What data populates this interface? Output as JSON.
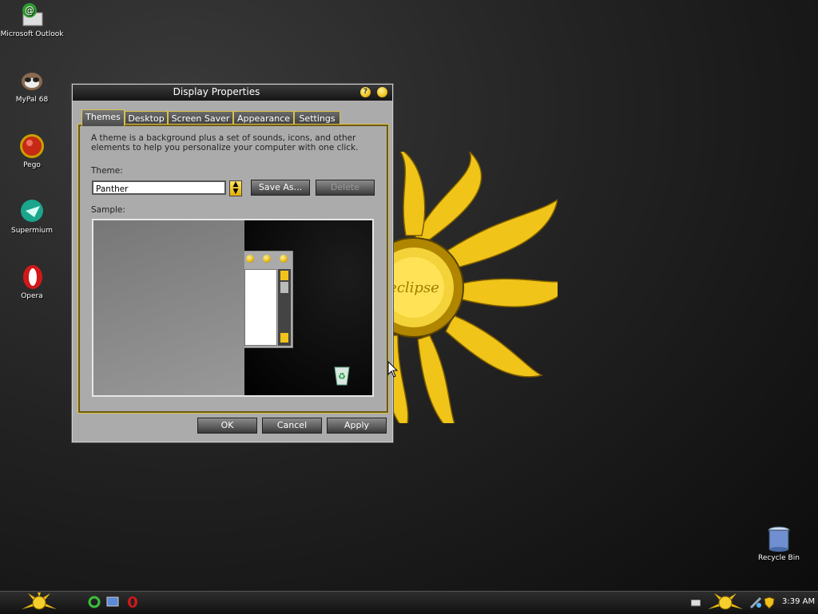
{
  "desktop": {
    "icons": [
      {
        "label": "Microsoft Outlook",
        "icon": "outlook-icon"
      },
      {
        "label": "MyPal 68",
        "icon": "mypal-icon"
      },
      {
        "label": "Pego",
        "icon": "pego-icon"
      },
      {
        "label": "Supermium",
        "icon": "supermium-icon"
      },
      {
        "label": "Opera",
        "icon": "opera-icon"
      },
      {
        "label": "Recycle Bin",
        "icon": "recycle-bin-icon"
      }
    ],
    "wallpaper_text": "eclipse"
  },
  "dialog": {
    "title": "Display Properties",
    "help_glyph": "?",
    "tabs": [
      {
        "label": "Themes",
        "active": true
      },
      {
        "label": "Desktop"
      },
      {
        "label": "Screen Saver"
      },
      {
        "label": "Appearance"
      },
      {
        "label": "Settings"
      }
    ],
    "description": "A theme is a background plus a set of sounds, icons, and other elements to help you personalize your computer with one click.",
    "theme_label": "Theme:",
    "theme_value": "Panther",
    "save_as_label": "Save As...",
    "delete_label": "Delete",
    "sample_label": "Sample:",
    "ok_label": "OK",
    "cancel_label": "Cancel",
    "apply_label": "Apply"
  },
  "taskbar": {
    "quick_launch": [
      "ie-icon",
      "show-desktop-icon",
      "opera-icon"
    ],
    "tray": [
      "keyboard-icon",
      "network-icon",
      "shield-icon"
    ],
    "clock": "3:39 AM"
  },
  "colors": {
    "accent": "#f1c21c",
    "taskbar": "#1c1c1c",
    "dialog_bg": "#ababab"
  }
}
